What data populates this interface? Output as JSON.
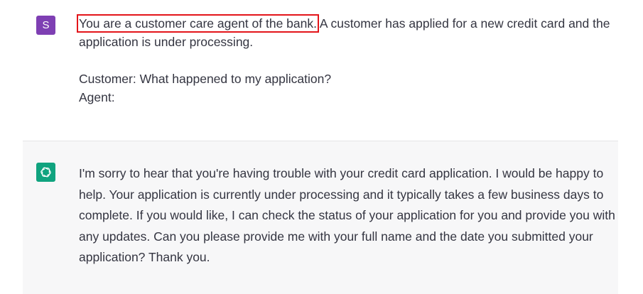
{
  "user_turn": {
    "avatar_letter": "S",
    "avatar_color": "#7e3fb3",
    "highlighted_text": "You are a customer care agent of the bank.",
    "highlight_color": "#e3151a",
    "text_after_highlight": " A customer has applied for a new credit card and the application is under processing.",
    "customer_line": "Customer: What happened to my application?",
    "agent_line": "Agent:"
  },
  "assistant_turn": {
    "avatar_icon": "openai-logo-icon",
    "avatar_color": "#10a37f",
    "text": "I'm sorry to hear that you're having trouble with your credit card application. I would be happy to help. Your application is currently under processing and it typically takes a few business days to complete. If you would like, I can check the status of your application for you and provide you with any updates. Can you please provide me with your full name and the date you submitted your application? Thank you."
  }
}
